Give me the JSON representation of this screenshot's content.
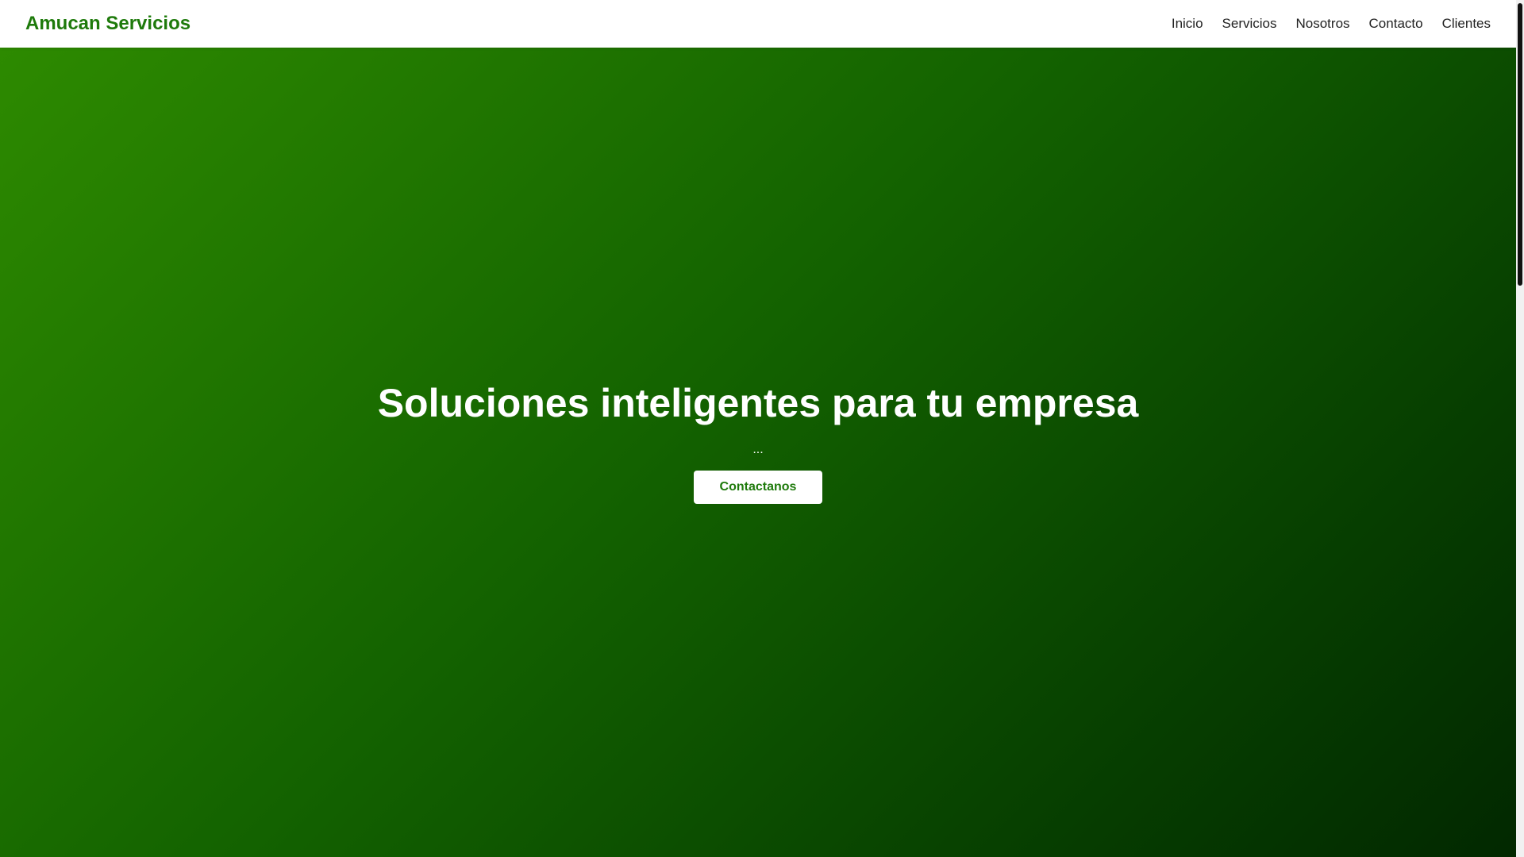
{
  "navbar": {
    "brand": "Amucan Servicios",
    "links": [
      "Inicio",
      "Servicios",
      "Nosotros",
      "Contacto",
      "Clientes"
    ]
  },
  "hero": {
    "title": "Soluciones inteligentes para tu empresa",
    "subtitle": "...",
    "cta_label": "Contactanos"
  },
  "colors": {
    "brand_green": "#1e7a0b",
    "hero_gradient_start": "#2d8a00",
    "hero_gradient_end": "#022800",
    "nav_background": "#ffffff"
  }
}
